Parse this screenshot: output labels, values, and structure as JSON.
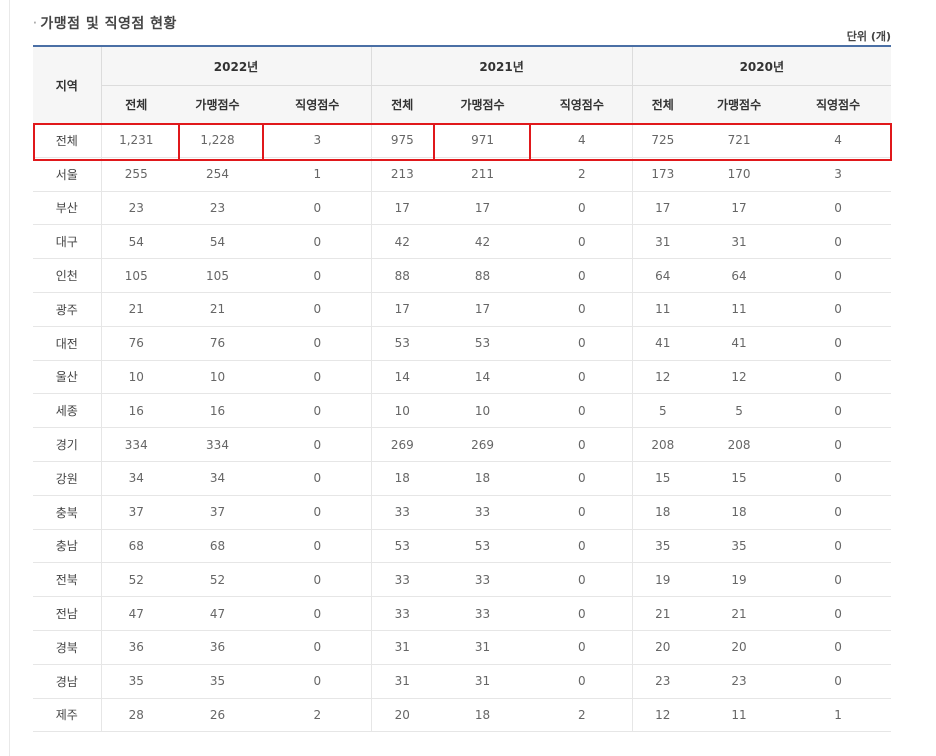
{
  "title": "가맹점 및 직영점 현황",
  "bullet": "·",
  "unit": "단위 (개)",
  "table": {
    "region_header": "지역",
    "years": [
      "2022년",
      "2021년",
      "2020년"
    ],
    "sub_headers": [
      "전체",
      "가맹점수",
      "직영점수",
      "전체",
      "가맹점수",
      "직영점수",
      "전체",
      "가맹점수",
      "직영점수"
    ],
    "rows": [
      [
        "전체",
        "1,231",
        "1,228",
        "3",
        "975",
        "971",
        "4",
        "725",
        "721",
        "4"
      ],
      [
        "서울",
        "255",
        "254",
        "1",
        "213",
        "211",
        "2",
        "173",
        "170",
        "3"
      ],
      [
        "부산",
        "23",
        "23",
        "0",
        "17",
        "17",
        "0",
        "17",
        "17",
        "0"
      ],
      [
        "대구",
        "54",
        "54",
        "0",
        "42",
        "42",
        "0",
        "31",
        "31",
        "0"
      ],
      [
        "인천",
        "105",
        "105",
        "0",
        "88",
        "88",
        "0",
        "64",
        "64",
        "0"
      ],
      [
        "광주",
        "21",
        "21",
        "0",
        "17",
        "17",
        "0",
        "11",
        "11",
        "0"
      ],
      [
        "대전",
        "76",
        "76",
        "0",
        "53",
        "53",
        "0",
        "41",
        "41",
        "0"
      ],
      [
        "울산",
        "10",
        "10",
        "0",
        "14",
        "14",
        "0",
        "12",
        "12",
        "0"
      ],
      [
        "세종",
        "16",
        "16",
        "0",
        "10",
        "10",
        "0",
        "5",
        "5",
        "0"
      ],
      [
        "경기",
        "334",
        "334",
        "0",
        "269",
        "269",
        "0",
        "208",
        "208",
        "0"
      ],
      [
        "강원",
        "34",
        "34",
        "0",
        "18",
        "18",
        "0",
        "15",
        "15",
        "0"
      ],
      [
        "충북",
        "37",
        "37",
        "0",
        "33",
        "33",
        "0",
        "18",
        "18",
        "0"
      ],
      [
        "충남",
        "68",
        "68",
        "0",
        "53",
        "53",
        "0",
        "35",
        "35",
        "0"
      ],
      [
        "전북",
        "52",
        "52",
        "0",
        "33",
        "33",
        "0",
        "19",
        "19",
        "0"
      ],
      [
        "전남",
        "47",
        "47",
        "0",
        "33",
        "33",
        "0",
        "21",
        "21",
        "0"
      ],
      [
        "경북",
        "36",
        "36",
        "0",
        "31",
        "31",
        "0",
        "20",
        "20",
        "0"
      ],
      [
        "경남",
        "35",
        "35",
        "0",
        "31",
        "31",
        "0",
        "23",
        "23",
        "0"
      ],
      [
        "제주",
        "28",
        "26",
        "2",
        "20",
        "18",
        "2",
        "12",
        "11",
        "1"
      ]
    ]
  },
  "colors": {
    "accent_rule": "#4a6fa5",
    "highlight": "#e0181b",
    "header_bg": "#f6f6f6"
  }
}
